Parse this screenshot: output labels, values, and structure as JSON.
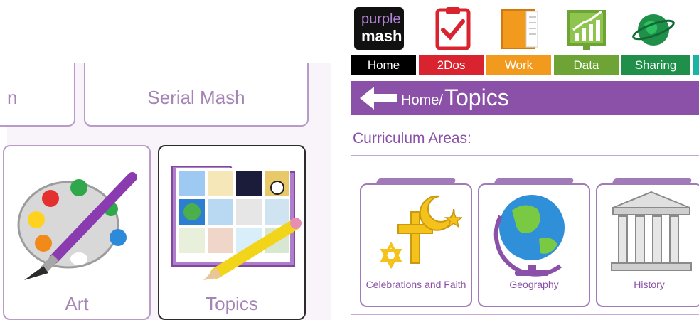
{
  "left": {
    "top_tiles": [
      {
        "label": "n"
      },
      {
        "label": "Serial Mash"
      }
    ],
    "bottom_tiles": [
      {
        "label": "Art",
        "icon": "art-palette-icon"
      },
      {
        "label": "Topics",
        "icon": "topics-folder-icon",
        "selected": true
      }
    ]
  },
  "right": {
    "logo": {
      "line1": "purple",
      "line2": "mash"
    },
    "nav_tabs": [
      {
        "label": "Home",
        "color": "#000000"
      },
      {
        "label": "2Dos",
        "color": "#d9242f"
      },
      {
        "label": "Work",
        "color": "#f29a1e"
      },
      {
        "label": "Data",
        "color": "#6ea436"
      },
      {
        "label": "Sharing",
        "color": "#1f8f4a"
      }
    ],
    "breadcrumb": {
      "home": "Home/",
      "current": "Topics"
    },
    "section_title": "Curriculum Areas:",
    "topics": [
      {
        "label": "Celebrations and Faith",
        "icon": "faith-symbols-icon"
      },
      {
        "label": "Geography",
        "icon": "globe-icon"
      },
      {
        "label": "History",
        "icon": "temple-icon"
      }
    ]
  }
}
